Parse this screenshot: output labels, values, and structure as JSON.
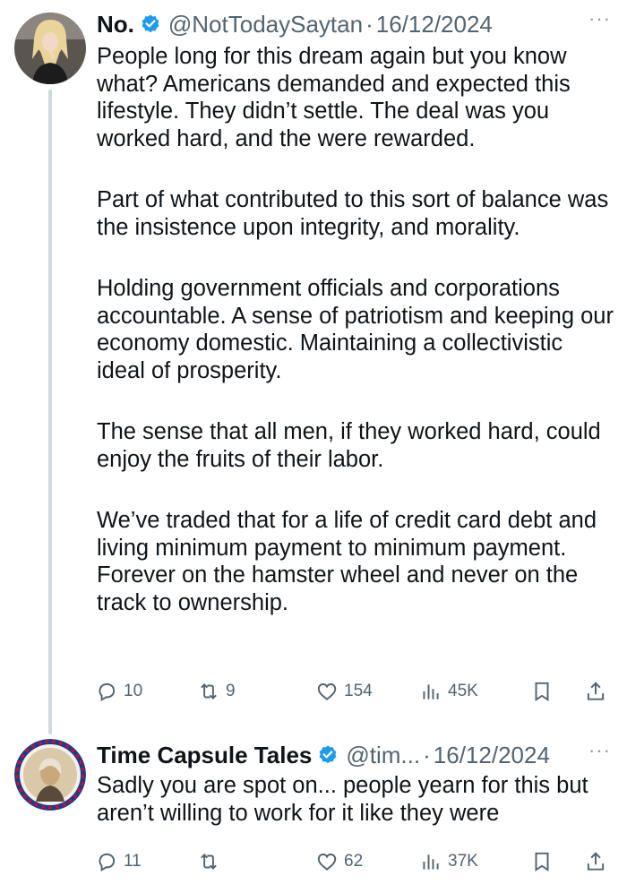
{
  "tweets": [
    {
      "display_name": "No.",
      "handle": "@NotTodaySaytan",
      "separator": "·",
      "date": "16/12/2024",
      "more": "···",
      "paragraphs": [
        "People long for this dream again but you know what? Americans demanded and expected this lifestyle. They didn’t settle. The deal was you worked hard, and the were rewarded.",
        "Part of what contributed to this sort of balance was the insistence upon integrity, and morality.",
        "Holding government officials and corporations accountable. A sense of patriotism and keeping our economy domestic.  Maintaining a collectivistic ideal of prosperity.",
        "The sense that all men, if they worked hard, could enjoy the fruits of their labor.",
        "We’ve traded that for a life of credit card debt and living minimum payment to minimum payment. Forever on the hamster wheel and never on the track to ownership."
      ],
      "replies": "10",
      "retweets": "9",
      "likes": "154",
      "views": "45K"
    },
    {
      "display_name": "Time Capsule Tales",
      "handle": "@tim...",
      "separator": "·",
      "date": "16/12/2024",
      "more": "···",
      "paragraphs": [
        "Sadly you are spot on... people yearn for this but aren’t willing to work for it like they were"
      ],
      "replies": "11",
      "retweets": "",
      "likes": "62",
      "views": "37K"
    }
  ],
  "colors": {
    "text": "#0f1419",
    "secondary": "#536471",
    "verified": "#1d9bf0",
    "thread_line": "#cfd9de"
  },
  "icons": [
    "verified-badge-icon",
    "more-options-icon",
    "reply-icon",
    "retweet-icon",
    "like-icon",
    "views-icon",
    "bookmark-icon",
    "share-icon"
  ]
}
